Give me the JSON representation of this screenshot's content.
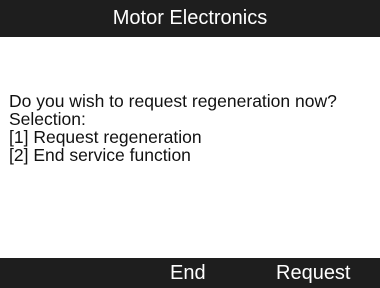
{
  "header": {
    "title": "Motor Electronics"
  },
  "dialog": {
    "question": "Do you wish to request regeneration now?",
    "selection_label": "Selection:",
    "options": [
      "[1]  Request regeneration",
      "[2]  End service function"
    ]
  },
  "footer": {
    "keys": [
      {
        "label": "End"
      },
      {
        "label": "Request"
      }
    ]
  },
  "colors": {
    "bar_background": "#1e1e1e",
    "bar_text": "#ffffff",
    "screen_background": "#ffffff",
    "body_text": "#111111"
  }
}
